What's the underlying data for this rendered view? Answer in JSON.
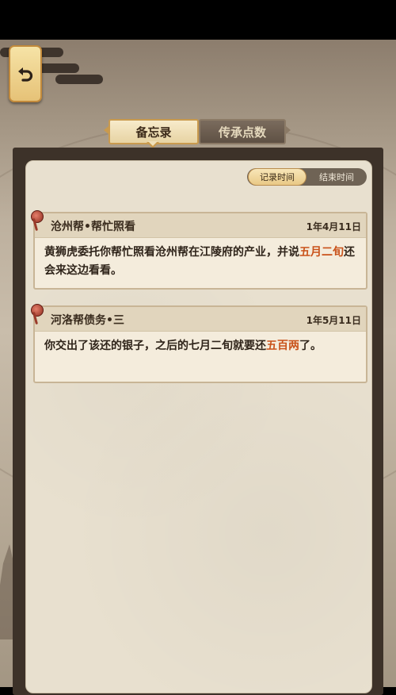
{
  "navigation": {
    "back_icon": "back-arrow-icon"
  },
  "tabs": [
    {
      "label": "备忘录",
      "active": true
    },
    {
      "label": "传承点数",
      "active": false
    }
  ],
  "sort": {
    "options": [
      {
        "label": "记录时间",
        "selected": true
      },
      {
        "label": "结束时间",
        "selected": false
      }
    ]
  },
  "memos": [
    {
      "title": "沧州帮•帮忙照看",
      "date": "1年4月11日",
      "text_before": "黄狮虎委托你帮忙照看沧州帮在江陵府的产业，并说",
      "highlight": "五月二旬",
      "text_after": "还会来这边看看。"
    },
    {
      "title": "河洛帮债务•三",
      "date": "1年5月11日",
      "text_before": "你交出了该还的银子，之后的七月二旬就要还",
      "highlight": "五百两",
      "text_after": "了。"
    }
  ],
  "colors": {
    "highlight": "#c9521a",
    "accent_gold": "#e9c986"
  }
}
